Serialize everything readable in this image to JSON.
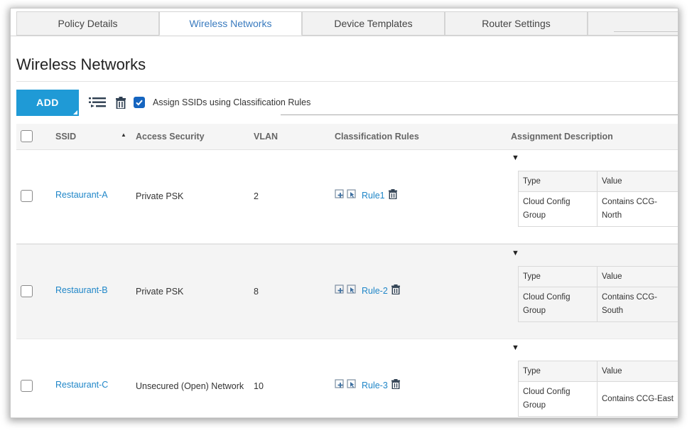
{
  "tabs": [
    {
      "label": "Policy Details",
      "active": false
    },
    {
      "label": "Wireless Networks",
      "active": true
    },
    {
      "label": "Device Templates",
      "active": false
    },
    {
      "label": "Router Settings",
      "active": false
    },
    {
      "label": "",
      "active": false
    }
  ],
  "page": {
    "title": "Wireless Networks"
  },
  "toolbar": {
    "add_label": "ADD",
    "reorder_icon": "reorder-list-icon",
    "delete_icon": "trash-icon",
    "assign_checkbox_checked": true,
    "assign_label": "Assign SSIDs using Classification Rules"
  },
  "table": {
    "columns": {
      "ssid": "SSID",
      "access": "Access Security",
      "vlan": "VLAN",
      "rules": "Classification Rules",
      "assignment": "Assignment Description"
    },
    "sort": "ascending",
    "rows": [
      {
        "ssid": "Restaurant-A",
        "access": "Private PSK",
        "vlan": "2",
        "rule": "Rule1",
        "desc": {
          "type_header": "Type",
          "value_header": "Value",
          "type": "Cloud Config Group",
          "value_line1": "Contains CCG-",
          "value_line2": "North"
        }
      },
      {
        "ssid": "Restaurant-B",
        "access": "Private PSK",
        "vlan": "8",
        "rule": "Rule-2",
        "desc": {
          "type_header": "Type",
          "value_header": "Value",
          "type": "Cloud Config Group",
          "value_line1": "Contains CCG-",
          "value_line2": "South"
        }
      },
      {
        "ssid": "Restaurant-C",
        "access": "Unsecured (Open) Network",
        "vlan": "10",
        "rule": "Rule-3",
        "desc": {
          "type_header": "Type",
          "value_header": "Value",
          "type": "Cloud Config Group",
          "value_line1": "Contains CCG-East",
          "value_line2": ""
        }
      }
    ]
  },
  "colors": {
    "accent": "#1f9ad6",
    "link": "#1f86c8",
    "checkbox": "#1565c0"
  }
}
